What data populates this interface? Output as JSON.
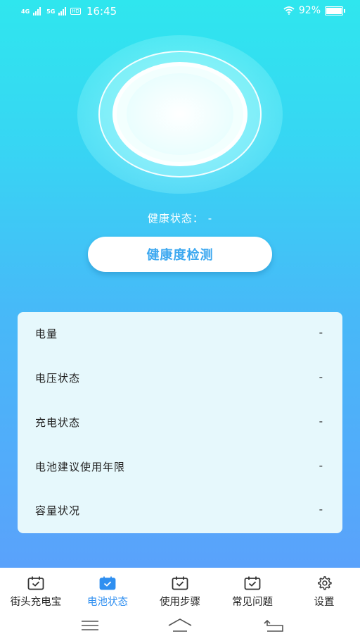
{
  "status_bar": {
    "net1": "4G",
    "net2": "5G",
    "hd": "HD",
    "time": "16:45",
    "battery": "92%"
  },
  "health": {
    "status_label": "健康状态：",
    "status_value": "-",
    "detect_button": "健康度检测"
  },
  "info": [
    {
      "label": "电量",
      "value": "-"
    },
    {
      "label": "电压状态",
      "value": "-"
    },
    {
      "label": "充电状态",
      "value": "-"
    },
    {
      "label": "电池建议使用年限",
      "value": "-"
    },
    {
      "label": "容量状况",
      "value": "-"
    }
  ],
  "tabs": [
    {
      "label": "街头充电宝",
      "icon": "calendar-check-icon",
      "active": false
    },
    {
      "label": "电池状态",
      "icon": "calendar-check-icon",
      "active": true
    },
    {
      "label": "使用步骤",
      "icon": "calendar-check-icon",
      "active": false
    },
    {
      "label": "常见问题",
      "icon": "calendar-check-icon",
      "active": false
    },
    {
      "label": "设置",
      "icon": "gear-icon",
      "active": false
    }
  ],
  "colors": {
    "accent": "#2f8ff0",
    "button_text": "#3ca8f0"
  }
}
